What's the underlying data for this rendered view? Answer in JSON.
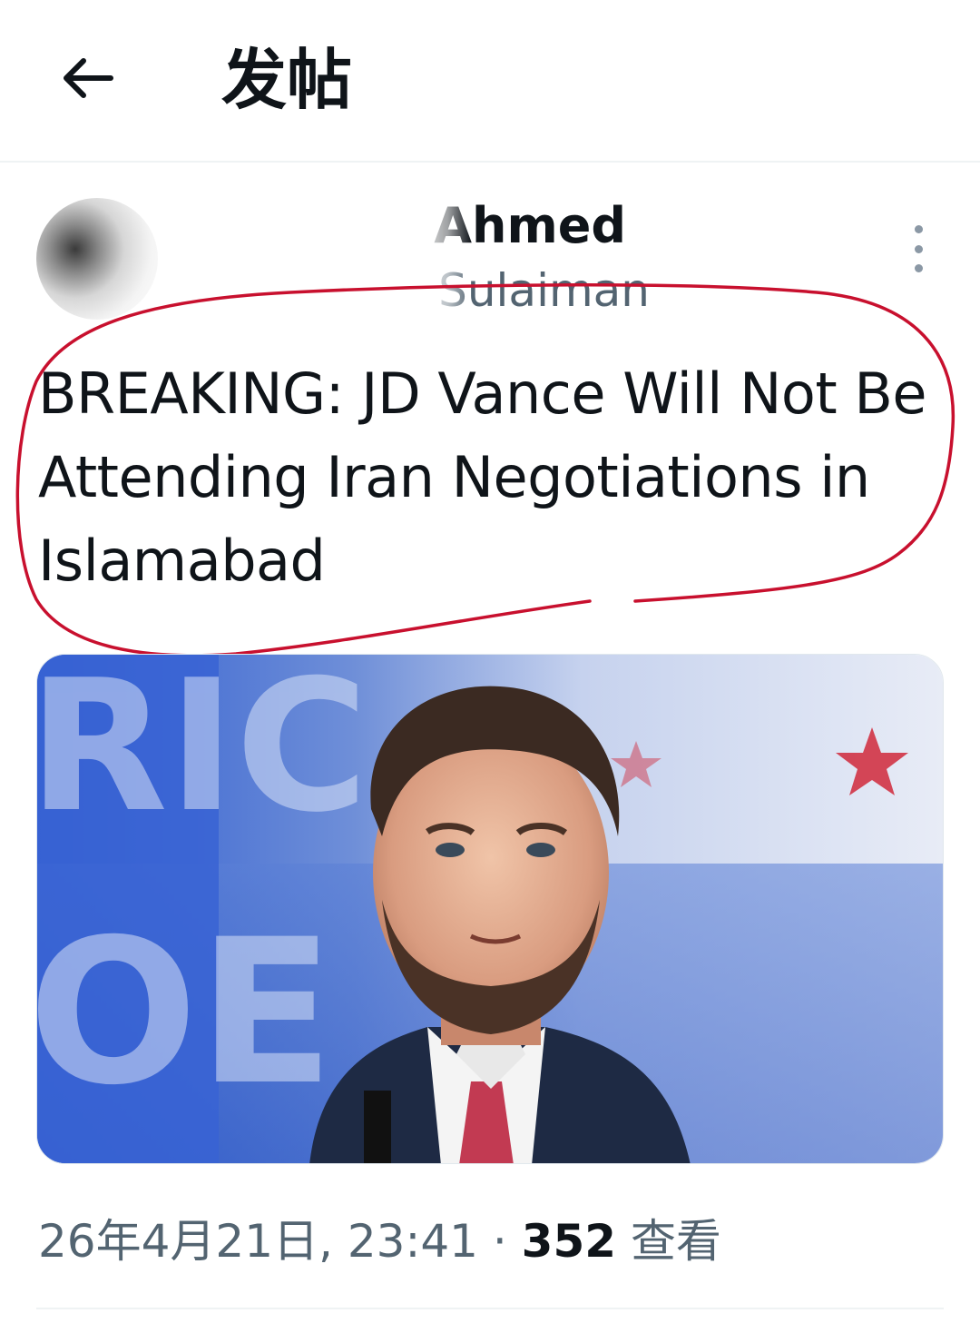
{
  "header": {
    "title": "发帖"
  },
  "author": {
    "display_name": "Ahmed",
    "handle": "Sulaiman"
  },
  "post": {
    "text": "BREAKING: JD Vance Will Not Be Attending Iran Negotiations in Islamabad"
  },
  "meta": {
    "timestamp": "26年4月21日, 23:41",
    "separator": "·",
    "views_count": "352",
    "views_label": "查看"
  },
  "icons": {
    "back": "arrow-left-icon",
    "more": "more-vertical-icon"
  },
  "colors": {
    "text_primary": "#0f1419",
    "text_secondary": "#536471",
    "annotation_red": "#c8102e",
    "divider": "#eff3f4"
  }
}
